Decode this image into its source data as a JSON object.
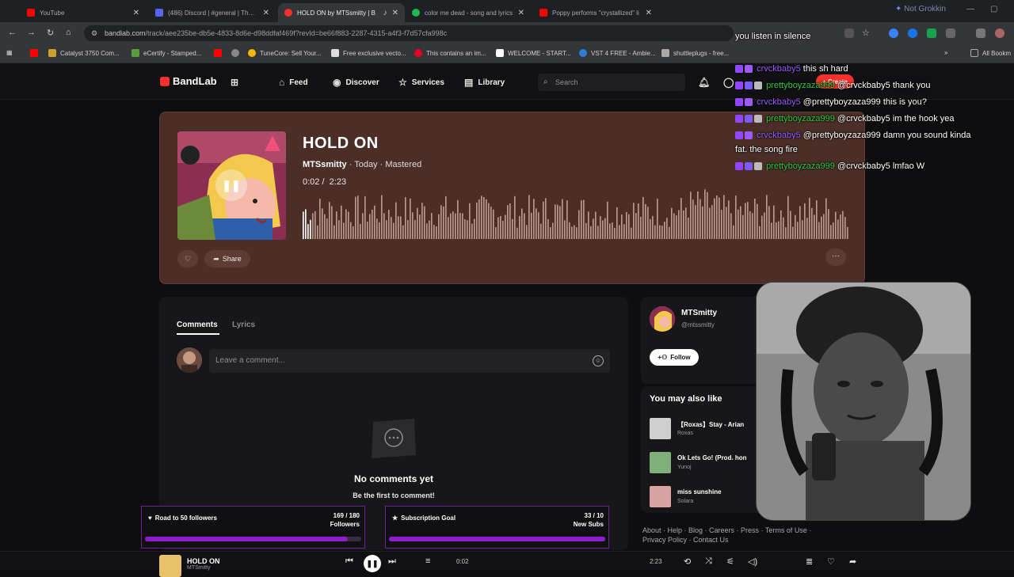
{
  "browser": {
    "tabs": [
      {
        "title": "YouTube",
        "color": "#ff0000"
      },
      {
        "title": "(486) Discord | #general | The R",
        "color": "#5865f2"
      },
      {
        "title": "HOLD ON by MTSsmitty | B",
        "color": "#f6322b",
        "active": true
      },
      {
        "title": "color me dead - song and lyrics",
        "color": "#1db954"
      },
      {
        "title": "Poppy performs \"crystallized\" li",
        "color": "#ff0000"
      }
    ],
    "profile_label": "Not Grokkin",
    "url_host": "bandlab.com",
    "url_path": "/track/aee235be-db5e-4833-8d6e-d98ddfaf469f?revId=be66f883-2287-4315-a4f3-f7d57cfa998c",
    "bookmarks": [
      {
        "label": "",
        "color": "#ff0000"
      },
      {
        "label": "Catalyst 3750 Com...",
        "color": "#c9a227"
      },
      {
        "label": "eCertify - Stamped...",
        "color": "#5a9e3a"
      },
      {
        "label": "",
        "color": "#ff0000"
      },
      {
        "label": "",
        "color": "#888888"
      },
      {
        "label": "TuneCore: Sell Your...",
        "color": "#f5b800"
      },
      {
        "label": "Free exclusive vecto...",
        "color": "#dddddd"
      },
      {
        "label": "This contains an im...",
        "color": "#e60023"
      },
      {
        "label": "WELCOME - START...",
        "color": "#ffffff"
      },
      {
        "label": "VST 4 FREE - Ambie...",
        "color": "#2d7dd2"
      },
      {
        "label": "shuttleplugs - free...",
        "color": "#aaaaaa"
      }
    ],
    "all_bookmarks": "All Bookm"
  },
  "bandlab": {
    "brand": "BandLab",
    "nav": [
      "Feed",
      "Discover",
      "Services",
      "Library"
    ],
    "search_placeholder": "Search",
    "create_label": "+ Create"
  },
  "track": {
    "title": "HOLD ON",
    "artist": "MTSsmitty",
    "meta": "· Today · Mastered",
    "time_current": "0:02",
    "time_total": "2:23",
    "share_label": "Share",
    "progress": 0.014
  },
  "comments": {
    "tabs": [
      "Comments",
      "Lyrics"
    ],
    "placeholder": "Leave a comment...",
    "empty_title": "No comments yet",
    "empty_sub": "Be the first to comment!"
  },
  "artist_card": {
    "name": "MTSmitty",
    "handle": "@mtssmitty",
    "follow_label": "Follow"
  },
  "recommendations": {
    "title": "You may also like",
    "items": [
      {
        "title": "【Roxas】Stay - Arian",
        "artist": "Roxas",
        "color": "#cfcfcf"
      },
      {
        "title": "Ok Lets Go! (Prod. hon",
        "artist": "Yunoj",
        "color": "#7fb07a"
      },
      {
        "title": "miss sunshine",
        "artist": "Solara",
        "color": "#d9a3a3"
      }
    ]
  },
  "footer_links_1": "About · Help · Blog · Careers · Press · Terms of Use ·",
  "footer_links_2": "Privacy Policy · Contact Us",
  "player": {
    "title": "HOLD ON",
    "artist": "MTSmitty",
    "time_current": "0:02",
    "time_total": "2:23"
  },
  "stream_goals": [
    {
      "label": "Road to 50 followers",
      "value": "169 / 180",
      "unit": "Followers",
      "fraction": 0.939
    },
    {
      "label": "Subscription Goal",
      "value": "33 / 10",
      "unit": "New Subs",
      "fraction": 1.0
    }
  ],
  "chat": [
    {
      "top_text": "you listen in silence"
    },
    {
      "user": "crvckbaby5",
      "user_class": "p",
      "msg": "this sh hard"
    },
    {
      "user": "prettyboyzaza999",
      "user_class": "g",
      "msg": "@crvckbaby5 thank you"
    },
    {
      "user": "crvckbaby5",
      "user_class": "p",
      "msg": "@prettyboyzaza999 this is you?"
    },
    {
      "user": "prettyboyzaza999",
      "user_class": "g",
      "msg": "@crvckbaby5 im the hook yea"
    },
    {
      "user": "crvckbaby5",
      "user_class": "p",
      "msg": "@prettyboyzaza999 damn you sound kinda"
    },
    {
      "msg_cont": "fat. the song fire"
    },
    {
      "user": "prettyboyzaza999",
      "user_class": "g",
      "msg": "@crvckbaby5 lmfao W"
    }
  ],
  "colors": {
    "card_bg": "#4a2e27",
    "accent_red": "#f6322b",
    "goal_purple": "#8c1ecf"
  }
}
